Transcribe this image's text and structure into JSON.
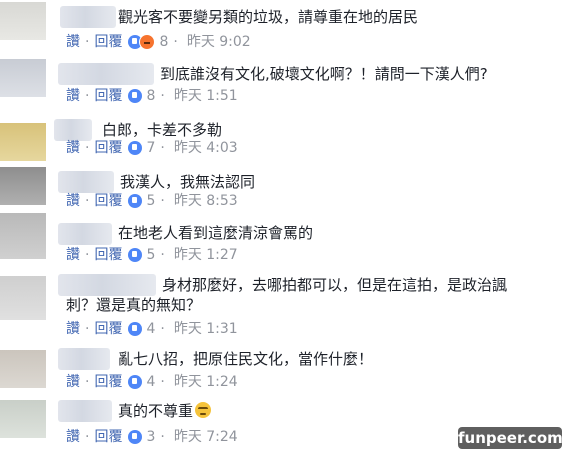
{
  "ui": {
    "like_label": "讚",
    "reply_label": "回覆",
    "separator": "·"
  },
  "comments": [
    {
      "text": "觀光客不要變另類的垃圾，請尊重在地的居民",
      "reactions": 8,
      "time": "昨天 9:02"
    },
    {
      "text": "到底誰沒有文化,破壞文化啊？！請問一下漢人們?",
      "reactions": 8,
      "time": "昨天 1:51"
    },
    {
      "text": "白郎，卡差不多勒",
      "reactions": 7,
      "time": "昨天 4:03"
    },
    {
      "text": "我漢人，我無法認同",
      "reactions": 5,
      "time": "昨天 8:53"
    },
    {
      "text": "在地老人看到這麼清涼會罵的",
      "reactions": 5,
      "time": "昨天 1:27"
    },
    {
      "text_line1": "身材那麼好，去哪拍都可以，但是在這拍，是政治諷",
      "text_line2": "刺？還是真的無知？",
      "reactions": 4,
      "time": "昨天 1:31"
    },
    {
      "text": "亂七八招，把原住民文化，當作什麼！",
      "reactions": 4,
      "time": "昨天 1:24"
    },
    {
      "text": "真的不尊重",
      "reactions": 3,
      "time": "昨天 7:24"
    }
  ],
  "watermark": "funpeer.com",
  "colors": {
    "link": "#4267b2",
    "meta": "#90949c",
    "text": "#1d2129",
    "like": "#4e86f7",
    "angry": "#f6732e"
  }
}
